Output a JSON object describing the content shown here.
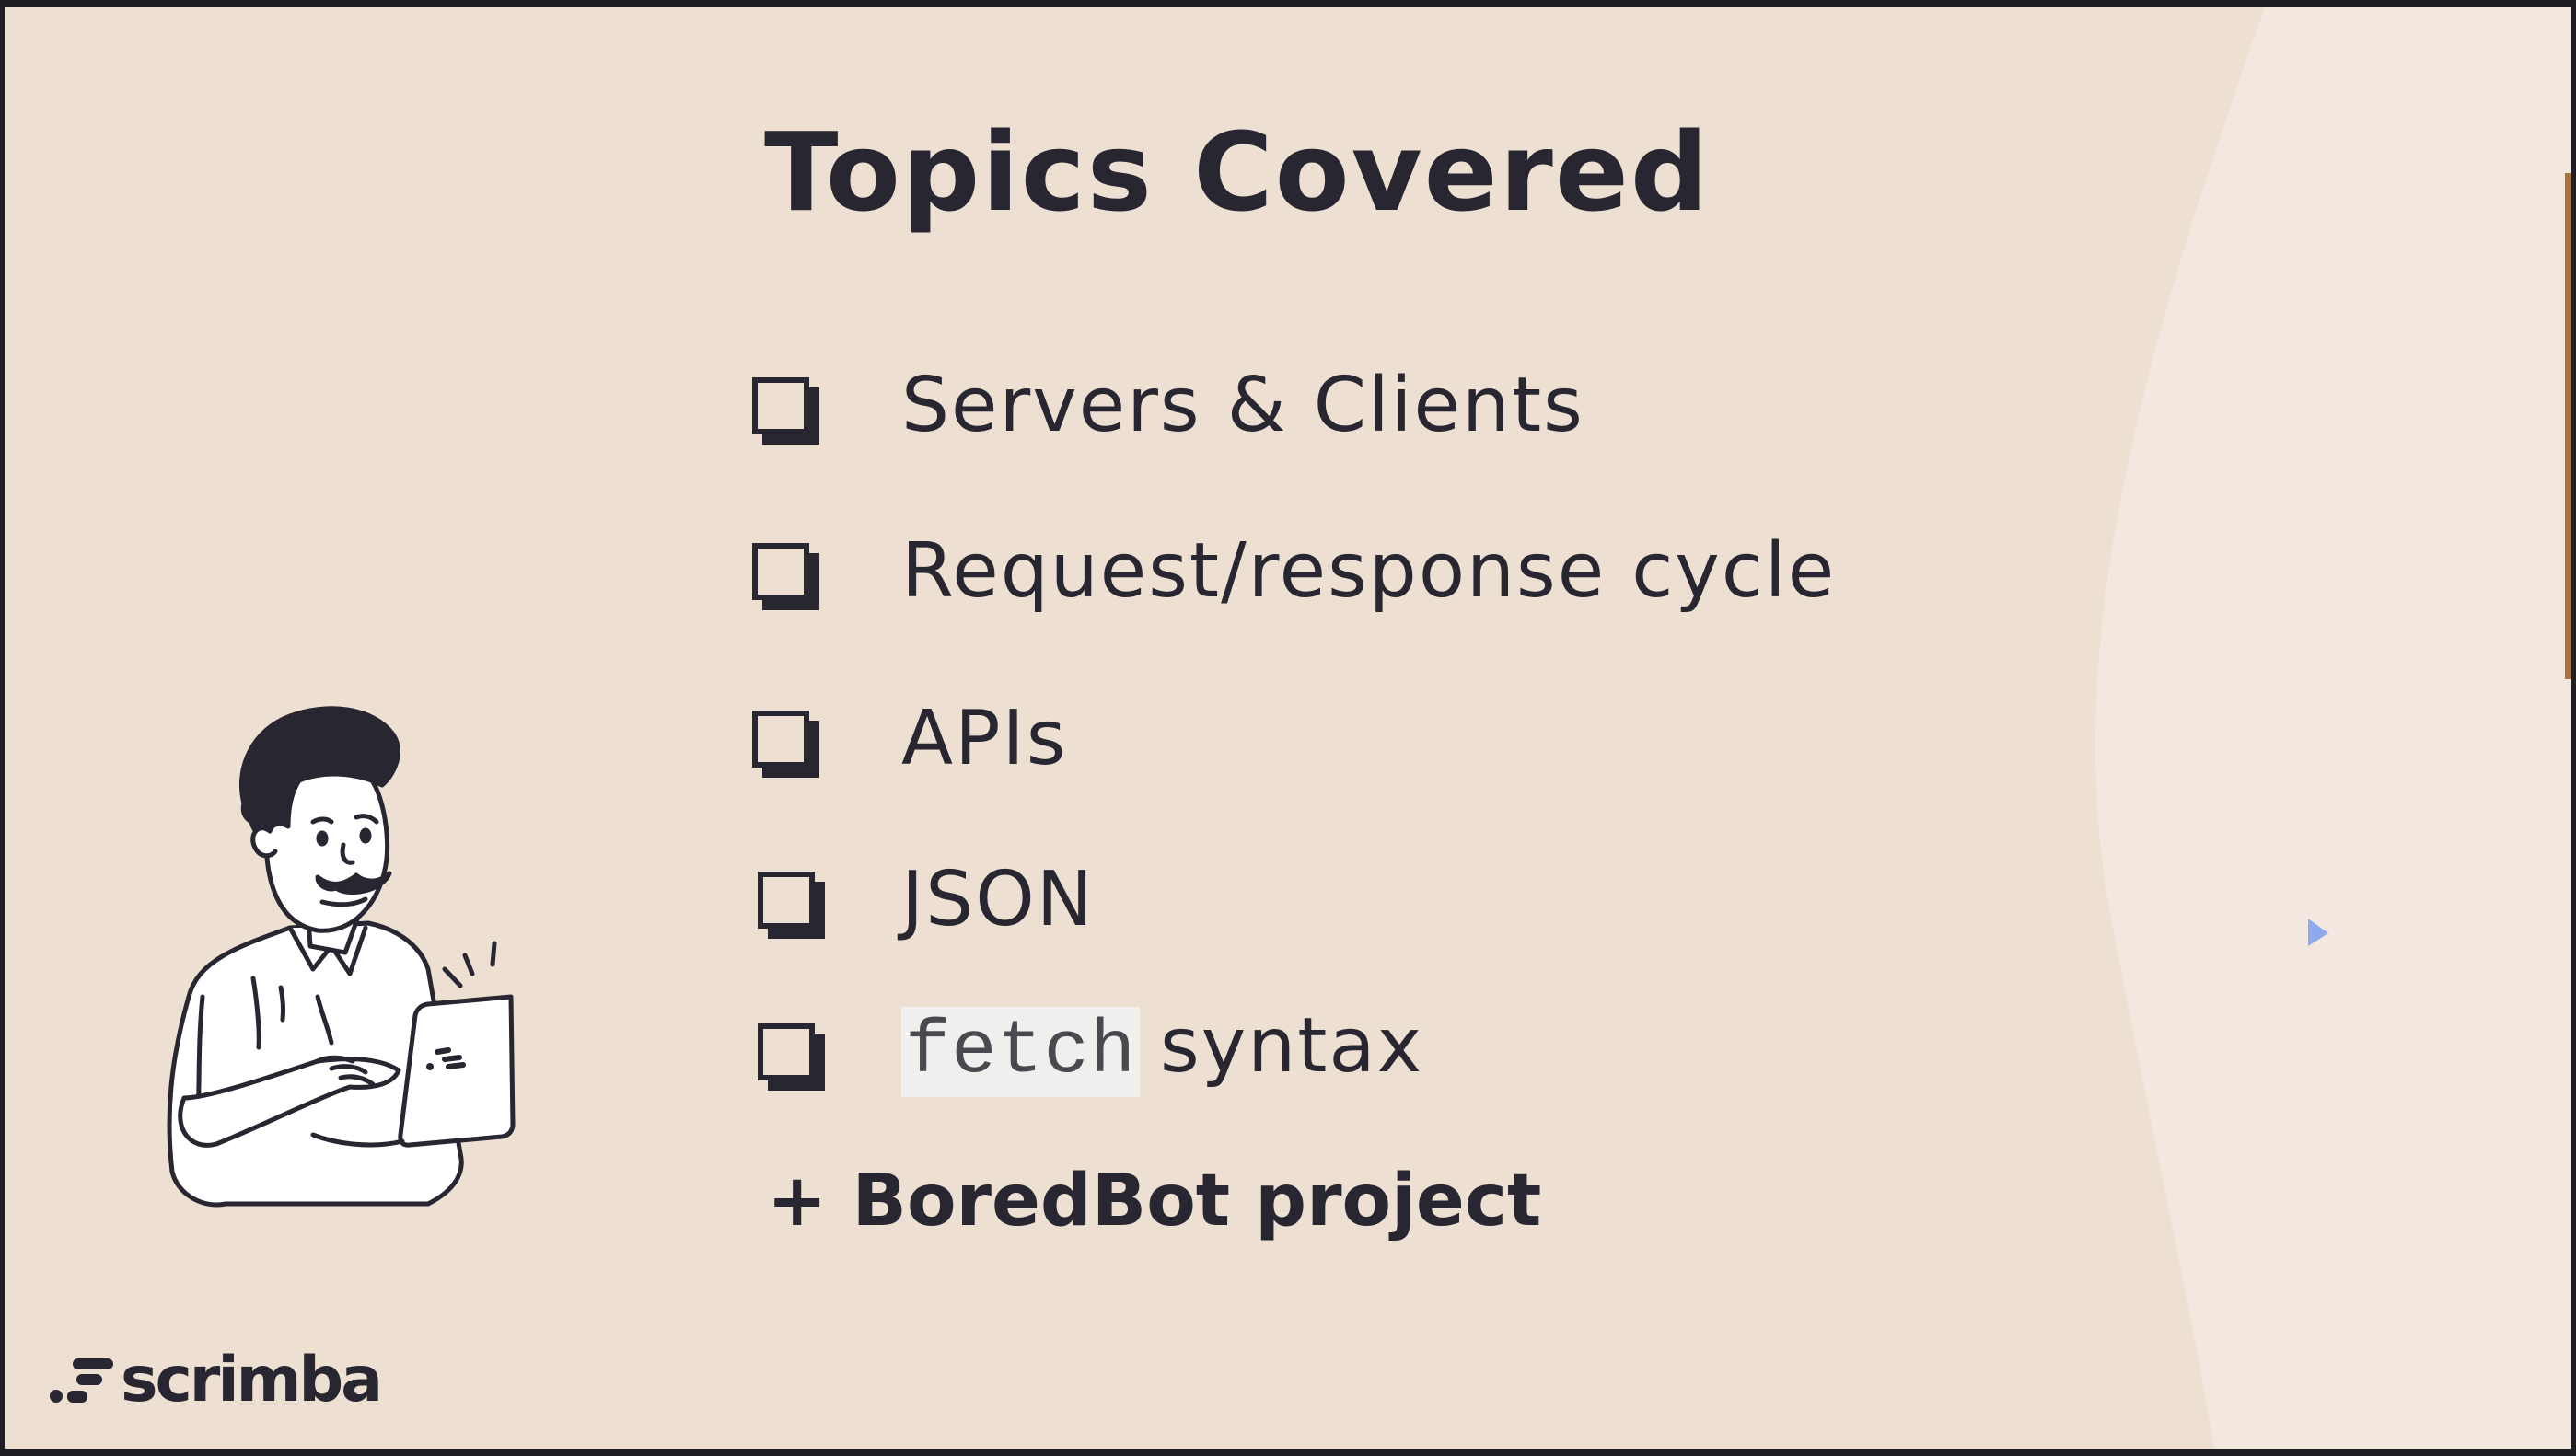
{
  "slide": {
    "title": "Topics Covered",
    "topics": [
      {
        "label": "Servers & Clients",
        "checked": false
      },
      {
        "label": "Request/response cycle",
        "checked": false
      },
      {
        "label": "APIs",
        "checked": false
      },
      {
        "label": "JSON",
        "checked": false
      },
      {
        "code": "fetch",
        "label": "syntax",
        "checked": false
      }
    ],
    "bonus": "+ BoredBot project",
    "brand": {
      "name": "scrimba"
    }
  },
  "colors": {
    "background": "#eedfd3",
    "background_light": "#f3e8df",
    "ink": "#272631",
    "code_chip": "#f1efee",
    "cursor": "#8fa9ee"
  },
  "icons": [
    "checkbox-icon",
    "scrimba-logo-icon",
    "mouse-cursor-icon"
  ]
}
